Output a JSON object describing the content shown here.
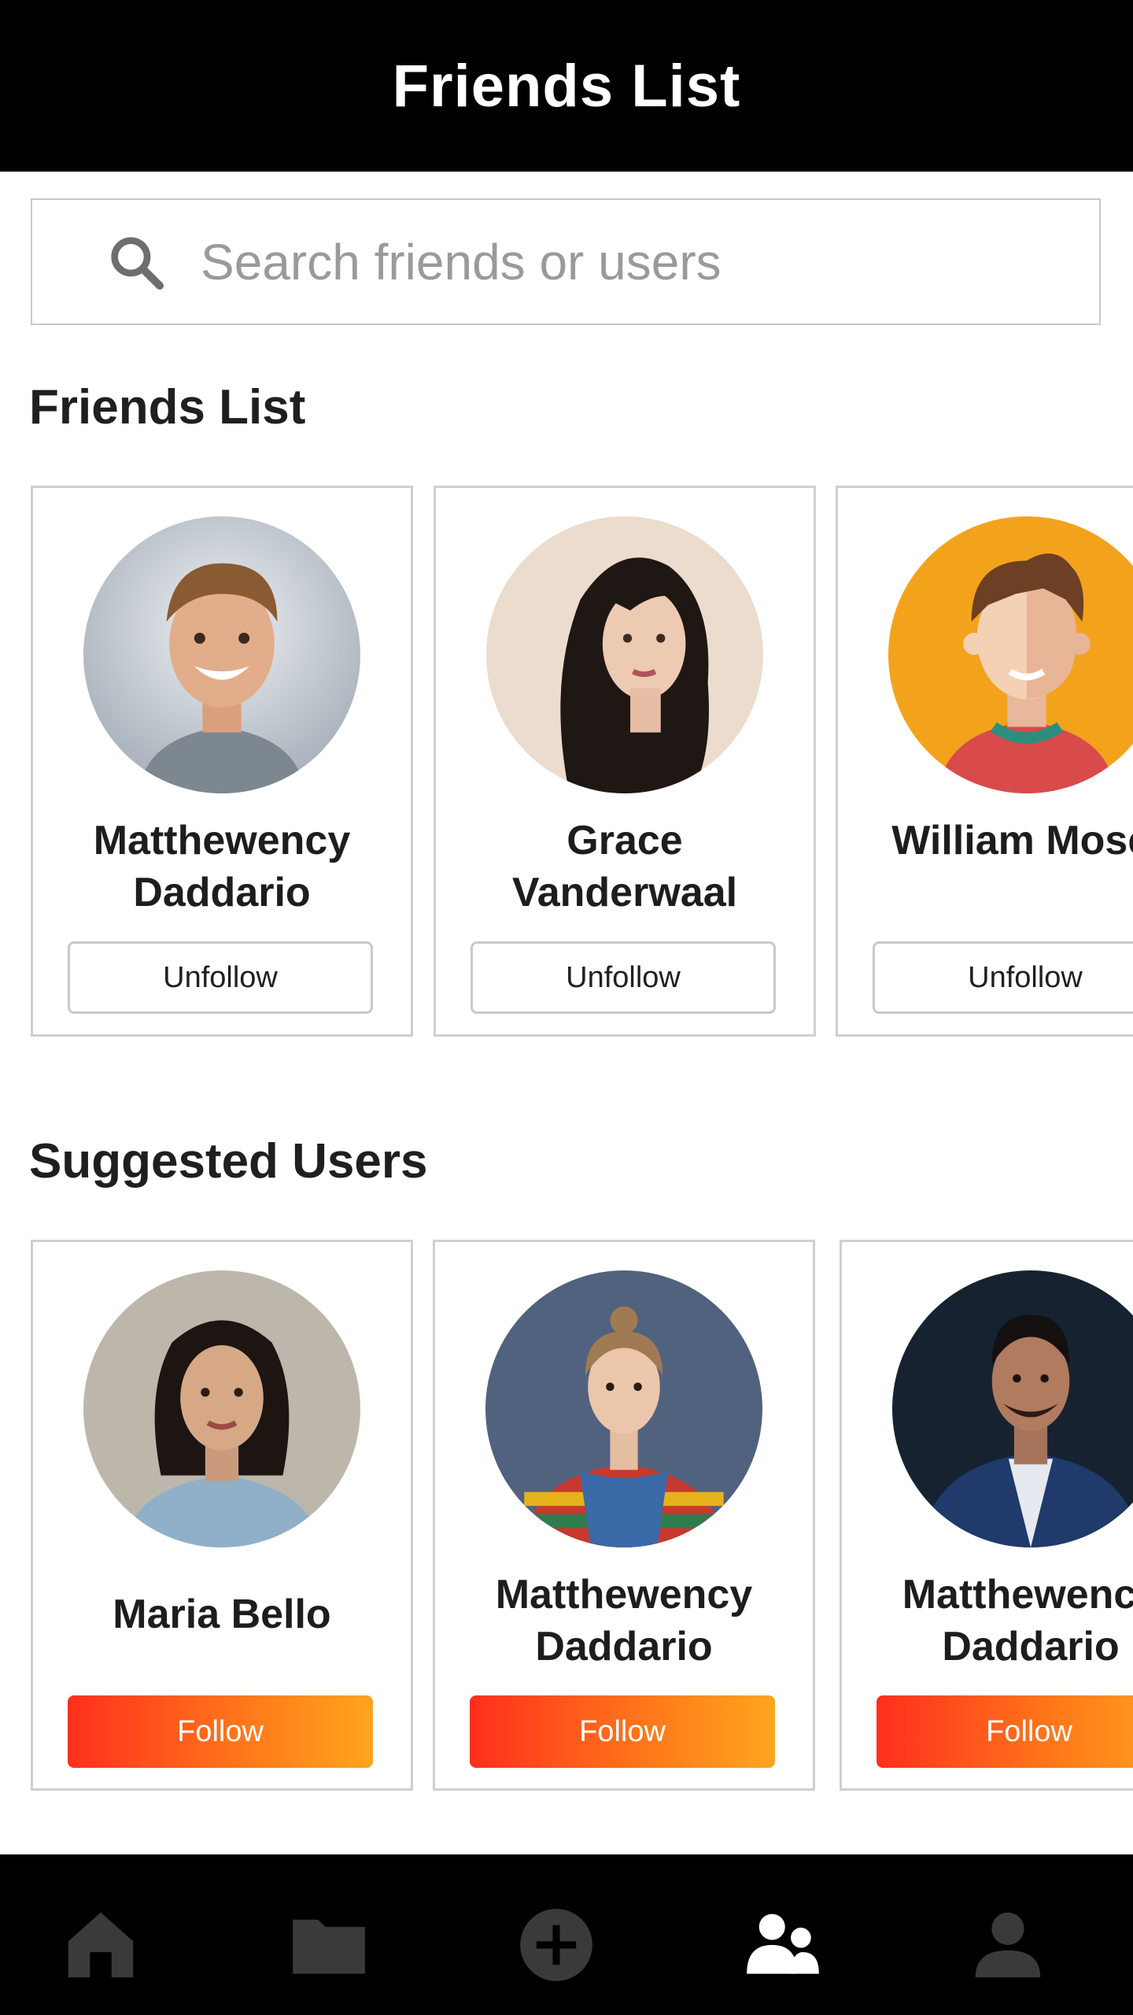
{
  "header": {
    "title": "Friends List"
  },
  "search": {
    "placeholder": "Search friends or users",
    "icon": "search-icon"
  },
  "friends_section": {
    "title": "Friends List",
    "cards": [
      {
        "name": "Matthewency Daddario",
        "name_lines": "Matthewency\nDaddario",
        "button": "Unfollow",
        "avatar": "photo-young-man-smiling"
      },
      {
        "name": "Grace Vanderwaal",
        "name_lines": "Grace\nVanderwaal",
        "button": "Unfollow",
        "avatar": "photo-woman-dark-hair"
      },
      {
        "name": "William Mosel",
        "name_lines": "William Mosel",
        "button": "Unfollow",
        "avatar": "illustrated-man-orange"
      }
    ]
  },
  "suggested_section": {
    "title": "Suggested Users",
    "cards": [
      {
        "name": "Maria Bello",
        "name_lines": "Maria Bello",
        "button": "Follow",
        "avatar": "photo-woman-denim-shirt"
      },
      {
        "name": "Matthewency Daddario",
        "name_lines": "Matthewency\nDaddario",
        "button": "Follow",
        "avatar": "photo-woman-striped-sweater"
      },
      {
        "name": "Matthewency Daddario",
        "name_lines": "Matthewency\nDaddario",
        "button": "Follow",
        "avatar": "photo-man-blue-blazer"
      }
    ]
  },
  "bottom_nav": [
    {
      "icon": "home-icon",
      "active": false
    },
    {
      "icon": "folder-icon",
      "active": false
    },
    {
      "icon": "add-circle-icon",
      "active": false
    },
    {
      "icon": "friends-icon",
      "active": true
    },
    {
      "icon": "profile-icon",
      "active": false
    }
  ],
  "colors": {
    "header_bg": "#000000",
    "follow_gradient_start": "#ff2f1d",
    "follow_gradient_end": "#ffa51e",
    "nav_inactive": "#3a3a3a",
    "nav_active": "#ffffff",
    "card_border": "#cfcfcf"
  }
}
